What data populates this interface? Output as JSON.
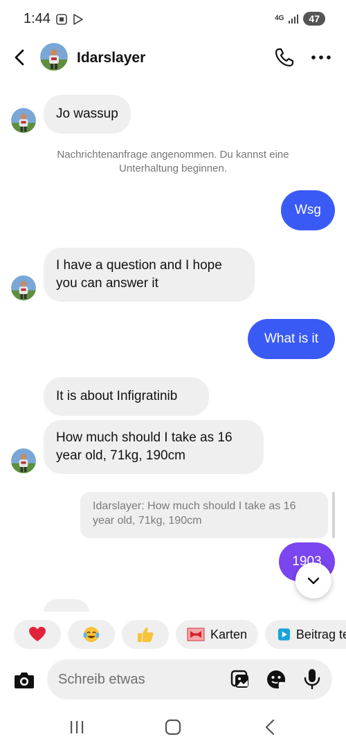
{
  "status_bar": {
    "time": "1:44",
    "network": "4G",
    "battery": "47"
  },
  "header": {
    "contact_name": "Idarslayer"
  },
  "messages": [
    {
      "id": "m1",
      "direction": "incoming",
      "text": "Jo wassup"
    },
    {
      "id": "sys",
      "direction": "system",
      "text": "Nachrichtenanfrage angenommen. Du kannst eine Unterhaltung beginnen."
    },
    {
      "id": "m2",
      "direction": "outgoing",
      "text": "Wsg"
    },
    {
      "id": "m3",
      "direction": "incoming",
      "text": "I have a question and I hope you can answer it"
    },
    {
      "id": "m4",
      "direction": "outgoing",
      "text": "What is it"
    },
    {
      "id": "m5",
      "direction": "incoming",
      "text": "It is about Infigratinib"
    },
    {
      "id": "m6",
      "direction": "incoming",
      "text": "How much should I take as 16 year old, 71kg, 190cm"
    },
    {
      "id": "m7",
      "direction": "outgoing",
      "text": "1903",
      "reply_to": "Idarslayer: How much should I take as 16 year old, 71kg, 190cm"
    }
  ],
  "quick_reactions": [
    {
      "icon": "red-heart-emoji",
      "label": "❤️"
    },
    {
      "icon": "tears-of-joy-emoji",
      "label": "😂"
    },
    {
      "icon": "thumbs-up-emoji",
      "label": "👍"
    },
    {
      "icon": "ribbon-card-icon",
      "label": "Karten"
    },
    {
      "icon": "play-post-icon",
      "label": "Beitrag teilen"
    }
  ],
  "composer": {
    "placeholder": "Schreib etwas"
  },
  "colors": {
    "outgoing_bubble": "#3a5af6",
    "outgoing_bubble_gradient_end": "#7b45ef",
    "incoming_bubble": "#efefef"
  }
}
